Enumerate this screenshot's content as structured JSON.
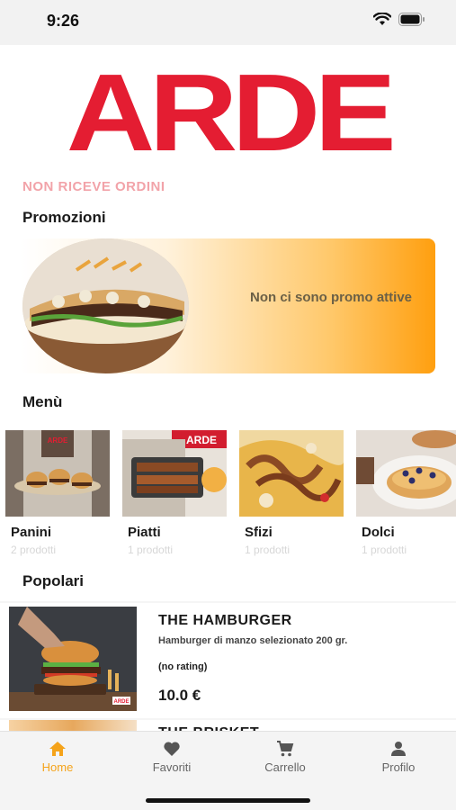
{
  "status_bar": {
    "time": "9:26"
  },
  "brand": {
    "logo_text": "ARDE",
    "color": "#e41d32"
  },
  "store_status": "NON RICEVE ORDINI",
  "promotions": {
    "title": "Promozioni",
    "empty_message": "Non ci sono promo attive"
  },
  "menu": {
    "title": "Menù",
    "categories": [
      {
        "name": "Panini",
        "count": "2 prodotti"
      },
      {
        "name": "Piatti",
        "count": "1 prodotti"
      },
      {
        "name": "Sfizi",
        "count": "1 prodotti"
      },
      {
        "name": "Dolci",
        "count": "1 prodotti"
      }
    ]
  },
  "popular": {
    "title": "Popolari",
    "items": [
      {
        "name": "THE HAMBURGER",
        "description": "Hamburger di manzo selezionato 200 gr.",
        "rating": "(no rating)",
        "price": "10.0 €"
      },
      {
        "name": "THE BRISKET"
      }
    ]
  },
  "tab_bar": {
    "accent_color": "#f5a31a",
    "tabs": [
      {
        "label": "Home",
        "icon": "home-icon",
        "active": true
      },
      {
        "label": "Favoriti",
        "icon": "heart-icon",
        "active": false
      },
      {
        "label": "Carrello",
        "icon": "cart-icon",
        "active": false
      },
      {
        "label": "Profilo",
        "icon": "person-icon",
        "active": false
      }
    ]
  }
}
